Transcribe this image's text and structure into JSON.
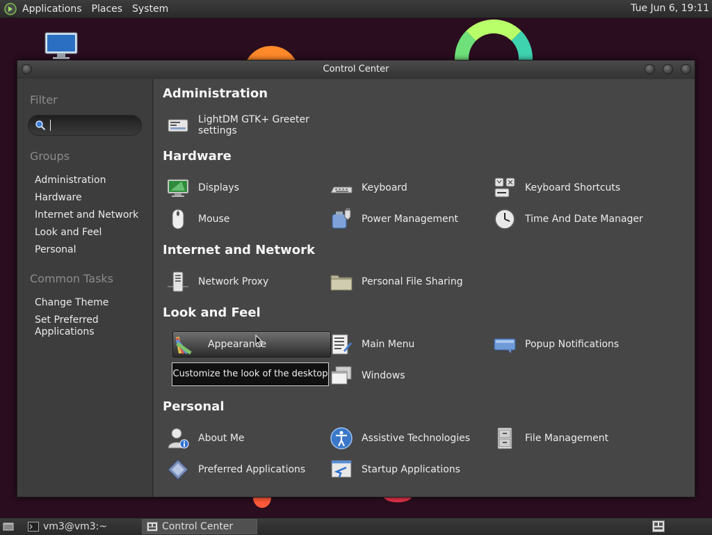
{
  "top_panel": {
    "menus": [
      "Applications",
      "Places",
      "System"
    ],
    "clock": "Tue Jun  6, 19:11"
  },
  "window": {
    "title": "Control Center"
  },
  "sidebar": {
    "filter_heading": "Filter",
    "search_placeholder": "",
    "search_value": "",
    "groups_heading": "Groups",
    "groups": [
      "Administration",
      "Hardware",
      "Internet and Network",
      "Look and Feel",
      "Personal"
    ],
    "common_tasks_heading": "Common Tasks",
    "tasks": [
      "Change Theme",
      "Set Preferred Applications"
    ]
  },
  "sections": {
    "administration": {
      "title": "Administration",
      "items": [
        {
          "label": "LightDM GTK+ Greeter settings",
          "icon": "display-manager-icon"
        }
      ]
    },
    "hardware": {
      "title": "Hardware",
      "items": [
        {
          "label": "Displays",
          "icon": "monitor-icon"
        },
        {
          "label": "Keyboard",
          "icon": "keyboard-icon"
        },
        {
          "label": "Keyboard Shortcuts",
          "icon": "keyboard-shortcuts-icon"
        },
        {
          "label": "Mouse",
          "icon": "mouse-icon"
        },
        {
          "label": "Power Management",
          "icon": "power-icon"
        },
        {
          "label": "Time And Date Manager",
          "icon": "clock-icon"
        }
      ]
    },
    "internet": {
      "title": "Internet and Network",
      "items": [
        {
          "label": "Network Proxy",
          "icon": "network-proxy-icon"
        },
        {
          "label": "Personal File Sharing",
          "icon": "folder-share-icon"
        }
      ]
    },
    "look": {
      "title": "Look and Feel",
      "items": [
        {
          "label": "Appearance",
          "icon": "appearance-icon"
        },
        {
          "label": "Main Menu",
          "icon": "main-menu-icon"
        },
        {
          "label": "Popup Notifications",
          "icon": "notification-icon"
        },
        {
          "label": "Windows",
          "icon": "windows-icon"
        }
      ]
    },
    "personal": {
      "title": "Personal",
      "items": [
        {
          "label": "About Me",
          "icon": "user-info-icon"
        },
        {
          "label": "Assistive Technologies",
          "icon": "accessibility-icon"
        },
        {
          "label": "File Management",
          "icon": "file-cabinet-icon"
        },
        {
          "label": "Preferred Applications",
          "icon": "preferred-apps-icon"
        },
        {
          "label": "Startup Applications",
          "icon": "startup-apps-icon"
        }
      ]
    }
  },
  "tooltip": "Customize the look of the desktop",
  "taskbar": {
    "tasks": [
      "vm3@vm3:~",
      "Control Center"
    ]
  },
  "colors": {
    "background": "#2a0d1f",
    "window_bg": "#464646",
    "sidebar_bg": "#3d3d3d",
    "hover_highlight": "#707070"
  }
}
